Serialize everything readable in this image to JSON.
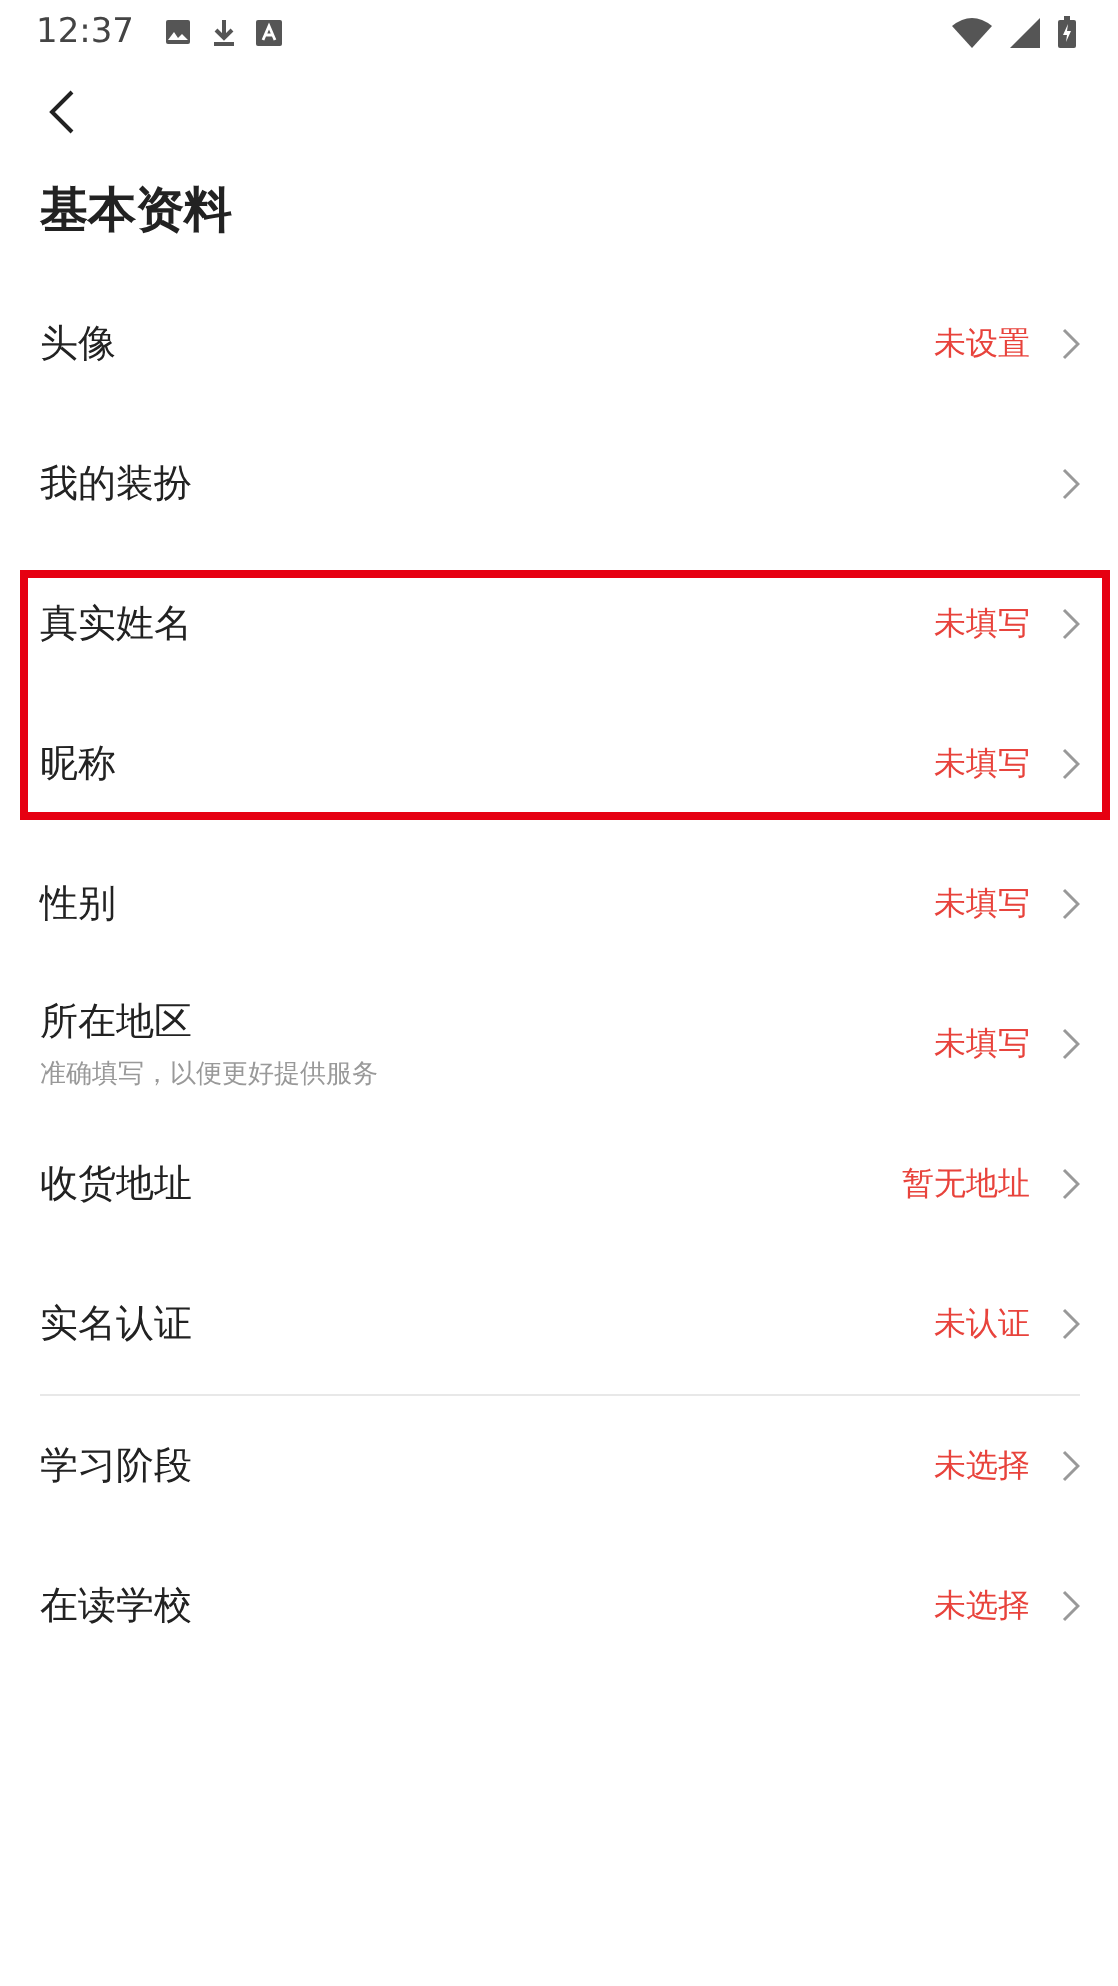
{
  "status_bar": {
    "time": "12:37"
  },
  "title": "基本资料",
  "groups": [
    {
      "kind": "plain",
      "rows": [
        {
          "label": "头像",
          "value": "未设置"
        },
        {
          "label": "我的装扮"
        }
      ]
    },
    {
      "kind": "highlighted",
      "rows": [
        {
          "label": "真实姓名",
          "value": "未填写"
        },
        {
          "label": "昵称",
          "value": "未填写"
        }
      ]
    },
    {
      "kind": "plain",
      "rows": [
        {
          "label": "性别",
          "value": "未填写"
        },
        {
          "label": "所在地区",
          "hint": "准确填写，以便更好提供服务",
          "value": "未填写"
        },
        {
          "label": "收货地址",
          "value": "暂无地址"
        },
        {
          "label": "实名认证",
          "value": "未认证"
        }
      ]
    },
    {
      "kind": "divided",
      "rows": [
        {
          "label": "学习阶段",
          "value": "未选择"
        },
        {
          "label": "在读学校",
          "value": "未选择"
        }
      ]
    }
  ]
}
